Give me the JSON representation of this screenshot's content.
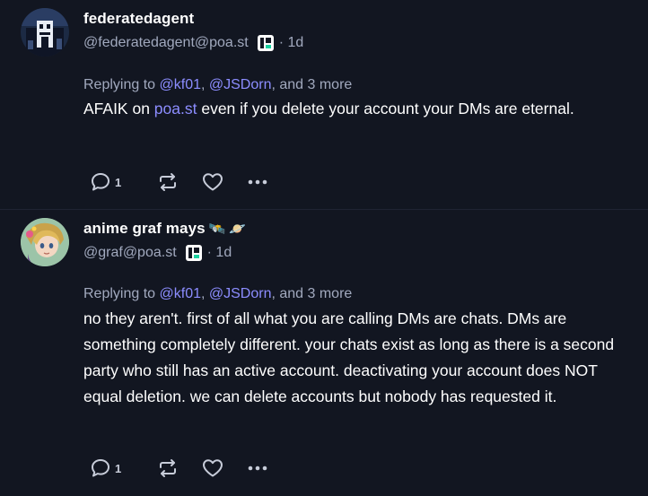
{
  "posts": [
    {
      "display_name": "federatedagent",
      "name_emojis": [],
      "handle": "@federatedagent@poa.st",
      "time": "· 1d",
      "reply_prefix": "Replying to ",
      "reply_mention_1": "@kf01",
      "reply_sep": ", ",
      "reply_mention_2": "@JSDorn",
      "reply_suffix": ", and 3 more",
      "body_before_link": "AFAIK on ",
      "body_link": "poa.st",
      "body_after_link": " even if you delete your account your DMs are eternal.",
      "reply_count": "1"
    },
    {
      "display_name": "anime graf mays",
      "name_emojis": [
        "🛰️",
        "🪐"
      ],
      "handle": "@graf@poa.st",
      "time": "· 1d",
      "reply_prefix": "Replying to ",
      "reply_mention_1": "@kf01",
      "reply_sep": ", ",
      "reply_mention_2": "@JSDorn",
      "reply_suffix": ", and 3 more",
      "body": "no they aren't. first of all what you are calling DMs are chats. DMs are something completely different. your chats exist as long as there is a second party who still has an active account. deactivating your account does NOT equal deletion. we can delete accounts but nobody has requested it.",
      "reply_count": "1"
    }
  ],
  "icons": {
    "reply": "reply-icon",
    "reblog": "repost-icon",
    "favourite": "heart-icon",
    "more": "more-icon",
    "instance_badge": "pleroma-icon"
  },
  "colors": {
    "background": "#121621",
    "text": "#ffffff",
    "muted": "#a1a9be",
    "accent": "#8c8dff"
  }
}
